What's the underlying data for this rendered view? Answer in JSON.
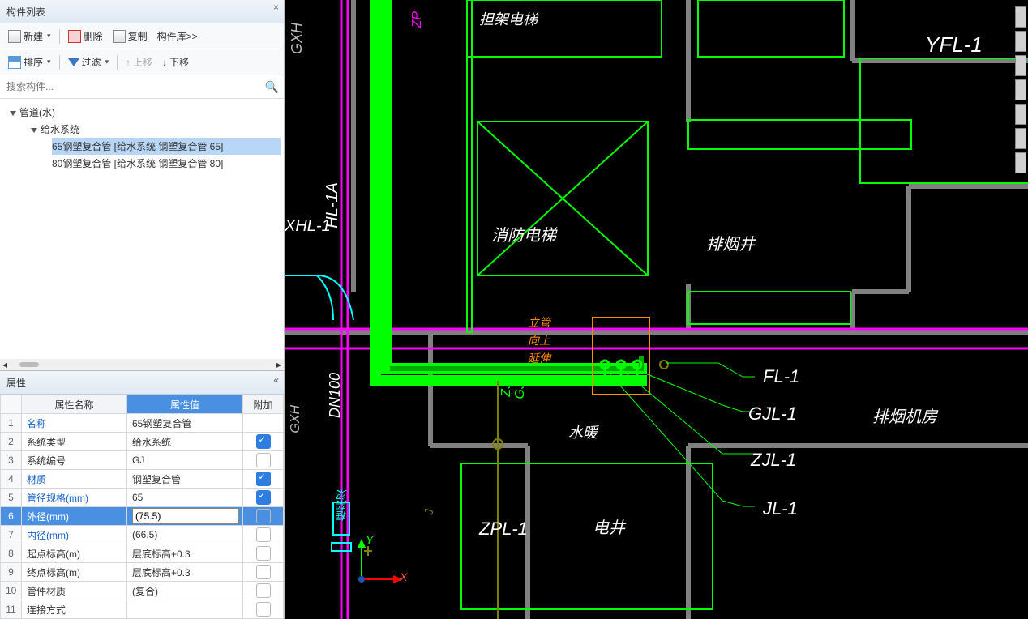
{
  "panel": {
    "title": "构件列表",
    "toolbar1": {
      "new": "新建",
      "del": "删除",
      "copy": "复制",
      "lib": "构件库>>"
    },
    "toolbar2": {
      "sort": "排序",
      "filter": "过滤",
      "up": "上移",
      "down": "下移"
    },
    "search_ph": "搜索构件..."
  },
  "tree": {
    "root": "管道(水)",
    "sub": "给水系统",
    "items": [
      "65钢塑复合管 [给水系统 钢塑复合管 65]",
      "80钢塑复合管 [给水系统 钢塑复合管 80]"
    ]
  },
  "prop": {
    "title": "属性",
    "cols": {
      "name": "属性名称",
      "value": "属性值",
      "extra": "附加"
    },
    "rows": [
      {
        "n": "1",
        "name": "名称",
        "val": "65钢塑复合管",
        "link": true,
        "chk": null
      },
      {
        "n": "2",
        "name": "系统类型",
        "val": "给水系统",
        "link": false,
        "chk": true
      },
      {
        "n": "3",
        "name": "系统编号",
        "val": "GJ",
        "link": false,
        "chk": false
      },
      {
        "n": "4",
        "name": "材质",
        "val": "钢塑复合管",
        "link": true,
        "chk": true
      },
      {
        "n": "5",
        "name": "管径规格(mm)",
        "val": "65",
        "link": true,
        "chk": true
      },
      {
        "n": "6",
        "name": "外径(mm)",
        "val": "(75.5)",
        "link": true,
        "chk": false,
        "sel": true,
        "edit": true
      },
      {
        "n": "7",
        "name": "内径(mm)",
        "val": "(66.5)",
        "link": true,
        "chk": false
      },
      {
        "n": "8",
        "name": "起点标高(m)",
        "val": "层底标高+0.3",
        "link": false,
        "chk": false
      },
      {
        "n": "9",
        "name": "终点标高(m)",
        "val": "层底标高+0.3",
        "link": false,
        "chk": false
      },
      {
        "n": "10",
        "name": "管件材质",
        "val": "(复合)",
        "link": false,
        "chk": false
      },
      {
        "n": "11",
        "name": "连接方式",
        "val": "",
        "link": false,
        "chk": false
      }
    ]
  },
  "cad": {
    "top_labels": {
      "stretcher": "担架电梯",
      "yfl": "YFL-1"
    },
    "mid_labels": {
      "xiaofang": "消防电梯",
      "paiyan": "排烟井"
    },
    "hl": "HL-1A",
    "xhl": "XHL-1",
    "gxh": "GXH",
    "zp": "ZP",
    "dn": "DN100",
    "riser": [
      "立管",
      "向上",
      "延伸"
    ],
    "legend": [
      "FL-1",
      "GJL-1",
      "ZJL-1",
      "JL-1"
    ],
    "pump": "排烟机房",
    "water": "水暖",
    "zj": "ZJ",
    "gj": "GJ",
    "j": "J",
    "zpl": "ZPL-1",
    "dianjing": "电井",
    "liang": "框架梁",
    "axes": {
      "x": "X",
      "y": "Y"
    }
  }
}
